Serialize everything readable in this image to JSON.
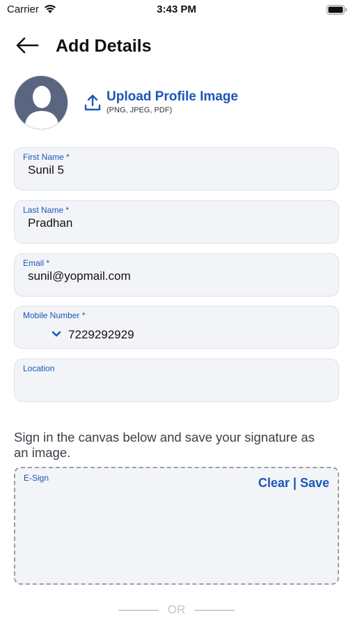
{
  "status_bar": {
    "carrier": "Carrier",
    "time": "3:43 PM"
  },
  "header": {
    "title": "Add Details",
    "back_icon": "arrow-left-icon"
  },
  "profile": {
    "avatar_icon": "person-silhouette-icon",
    "upload_label": "Upload Profile Image",
    "upload_hint": "(PNG, JPEG, PDF)",
    "upload_icon": "upload-icon"
  },
  "form": {
    "first_name": {
      "label": "First Name *",
      "value": "Sunil 5"
    },
    "last_name": {
      "label": "Last Name *",
      "value": "Pradhan"
    },
    "email": {
      "label": "Email *",
      "value": "sunil@yopmail.com"
    },
    "mobile": {
      "label": "Mobile Number  *",
      "value": "7229292929",
      "code_icon": "chevron-down-icon"
    },
    "location": {
      "label": "Location",
      "value": ""
    }
  },
  "signature": {
    "instruction": "Sign in the canvas below and save your signature as an image.",
    "canvas_label": "E-Sign",
    "clear_label": "Clear",
    "separator": " | ",
    "save_label": "Save"
  },
  "divider": {
    "text": "OR"
  },
  "colors": {
    "accent": "#1a56b8",
    "field_bg": "#f2f4f7",
    "avatar_bg": "#5a6680"
  }
}
